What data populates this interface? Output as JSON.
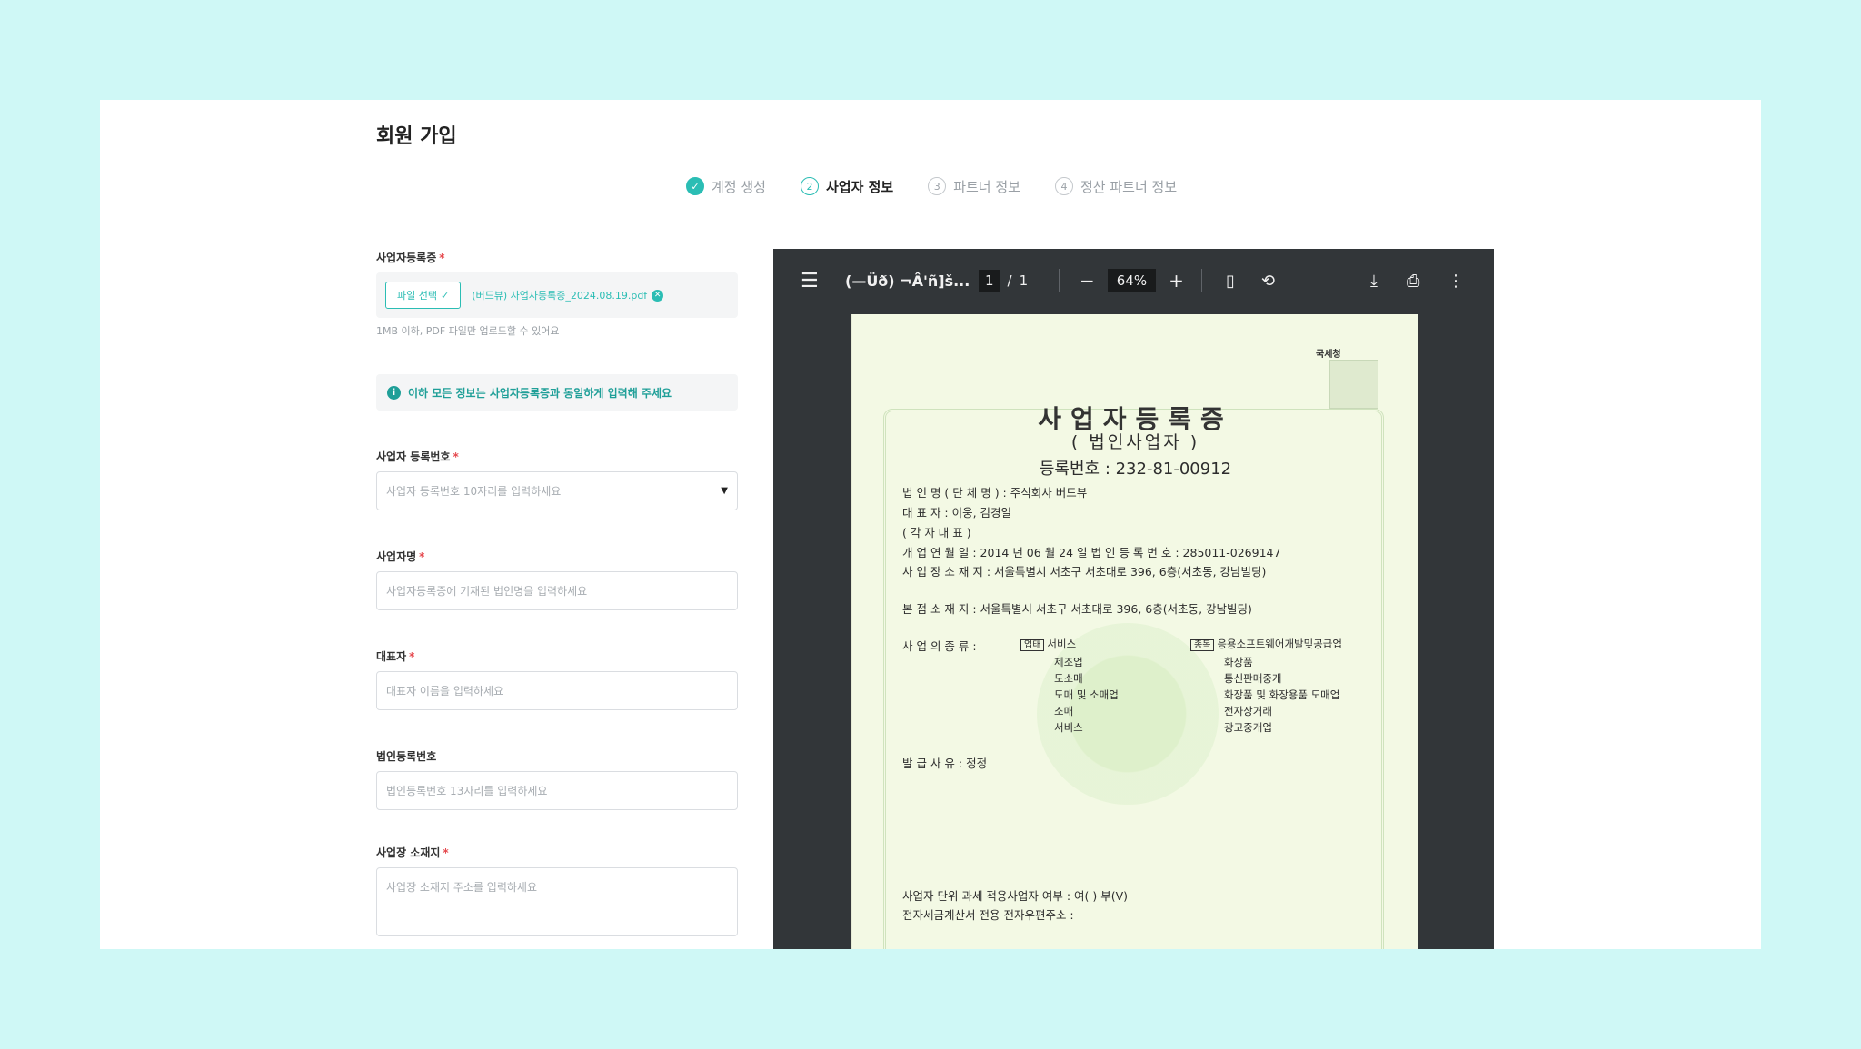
{
  "page": {
    "title": "회원 가입",
    "steps": [
      {
        "num": "✓",
        "label": "계정 생성",
        "state": "done"
      },
      {
        "num": "2",
        "label": "사업자 정보",
        "state": "active"
      },
      {
        "num": "3",
        "label": "파트너 정보",
        "state": "todo"
      },
      {
        "num": "4",
        "label": "정산 파트너 정보",
        "state": "todo"
      }
    ]
  },
  "form": {
    "license": {
      "label": "사업자등록증",
      "file_button": "파일 선택",
      "file_name": "(버드뷰) 사업자등록증_2024.08.19.pdf",
      "helper": "1MB 이하, PDF 파일만 업로드할 수 있어요"
    },
    "notice": "이하 모든 정보는 사업자등록증과 동일하게 입력해 주세요",
    "biz_number": {
      "label": "사업자 등록번호",
      "placeholder": "사업자 등록번호 10자리를 입력하세요"
    },
    "biz_name": {
      "label": "사업자명",
      "placeholder": "사업자등록증에 기재된 법인명을 입력하세요"
    },
    "ceo": {
      "label": "대표자",
      "placeholder": "대표자 이름을 입력하세요"
    },
    "corp_number": {
      "label": "법인등록번호",
      "placeholder": "법인등록번호 13자리를 입력하세요"
    },
    "address": {
      "label": "사업장 소재지",
      "placeholder": "사업장 소재지 주소를 입력하세요"
    },
    "required_mark": "*"
  },
  "viewer": {
    "title": "(—Üð) ¬Â'ñ]š...",
    "page_current": "1",
    "page_sep": "/",
    "page_total": "1",
    "zoom": "64%",
    "document": {
      "stamp_label": "국세청",
      "title": "사업자등록증",
      "subtitle": "( 법인사업자 )",
      "reg_number": "등록번호 : 232-81-00912",
      "lines": [
        "법 인 명 ( 단 체 명 )  :  주식회사 버드뷰",
        "대          표          자  :  이웅, 김경일",
        "( 각 자 대 표 )",
        "개  업  연  월  일  :  2014 년 06 월 24 일       법 인 등 록 번 호  :  285011-0269147",
        "사  업  장   소  재  지  :  서울특별시 서초구 서초대로 396, 6층(서초동, 강남빌딩)",
        "본   점   소   재   지  :  서울특별시 서초구 서초대로 396, 6층(서초동, 강남빌딩)",
        "사   업   의    종   류  :",
        "발     급     사     유  :  정정",
        "사업자 단위 과세 적용사업자 여부  :  여(  ) 부(V)",
        "전자세금계산서 전용 전자우편주소  :"
      ],
      "tag_business": "업태",
      "tag_item": "종목",
      "business_types": [
        "서비스",
        "제조업",
        "도소매",
        "도매 및 소매업",
        "소매",
        "서비스"
      ],
      "items": [
        "응용소프트웨어개발및공급업",
        "화장품",
        "통신판매중개",
        "화장품 및 화장용품 도매업",
        "전자상거래",
        "광고중개업"
      ]
    }
  },
  "colors": {
    "accent": "#2bbdb4",
    "background": "#cff8f6",
    "viewer": "#323639"
  }
}
